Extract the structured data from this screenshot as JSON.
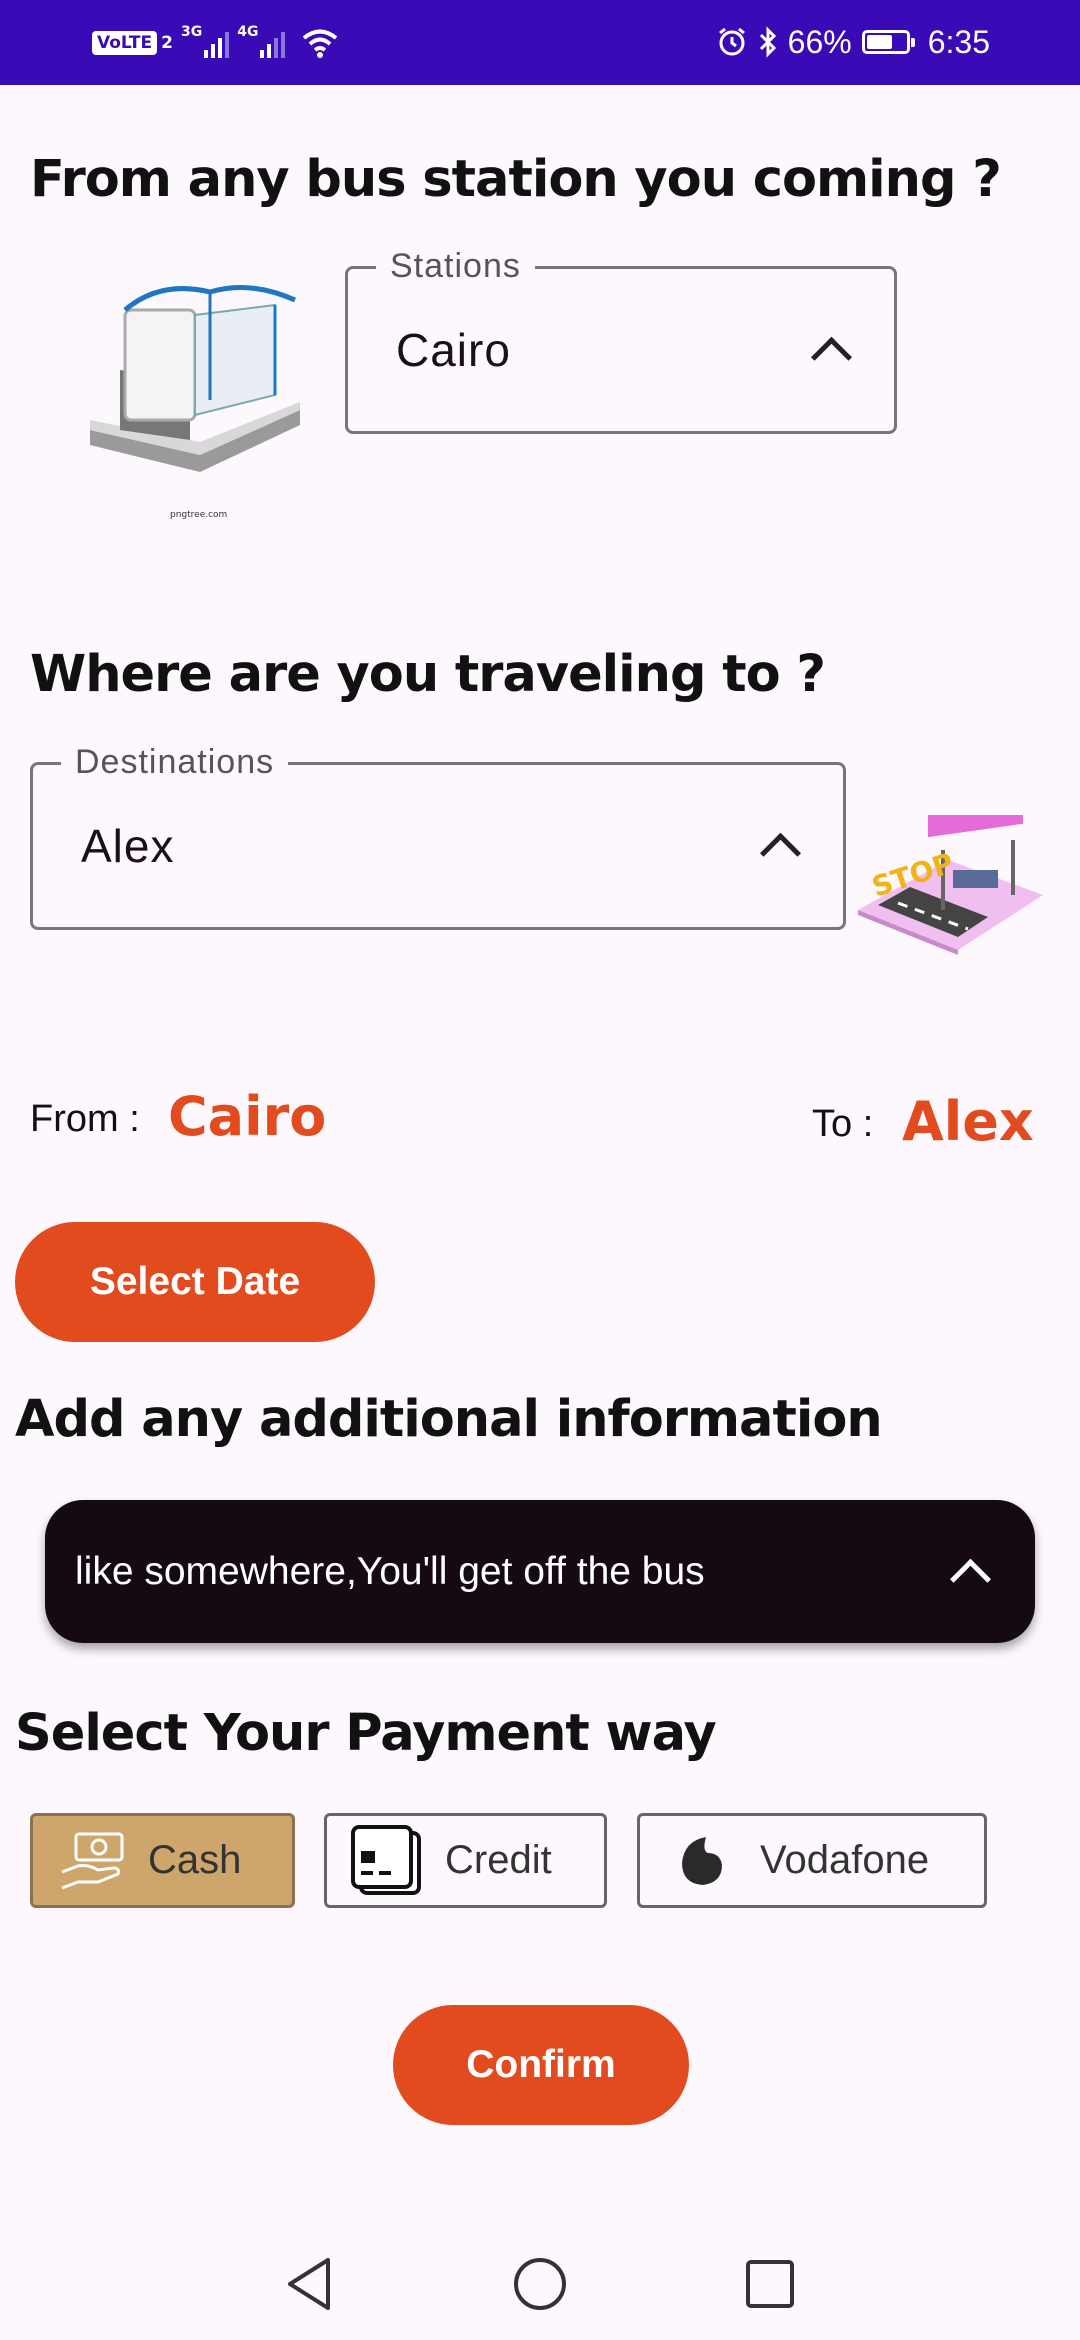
{
  "status_bar": {
    "volte": "VoLTE",
    "volte_sub": "2",
    "network_1": "3G",
    "network_2": "4G",
    "battery": "66%",
    "time": "6:35"
  },
  "origin": {
    "heading": "From any bus station you coming ?",
    "field_label": "Stations",
    "selected": "Cairo",
    "image_caption": "pngtree.com"
  },
  "destination": {
    "heading": "Where are you traveling to ?",
    "field_label": "Destinations",
    "selected": "Alex"
  },
  "route": {
    "from_label": "From :",
    "from_value": "Cairo",
    "to_label": "To :",
    "to_value": "Alex"
  },
  "select_date_label": "Select Date",
  "additional": {
    "heading": "Add any additional information",
    "placeholder": "like somewhere,You'll get off the bus"
  },
  "payment": {
    "heading": "Select Your Payment way",
    "options": [
      {
        "label": "Cash",
        "selected": true
      },
      {
        "label": "Credit",
        "selected": false
      },
      {
        "label": "Vodafone",
        "selected": false
      }
    ]
  },
  "confirm_label": "Confirm",
  "colors": {
    "status_bar": "#3a0ab6",
    "accent": "#e14b1e",
    "selected_payment": "#cea56a",
    "info_bar": "#150a14"
  }
}
